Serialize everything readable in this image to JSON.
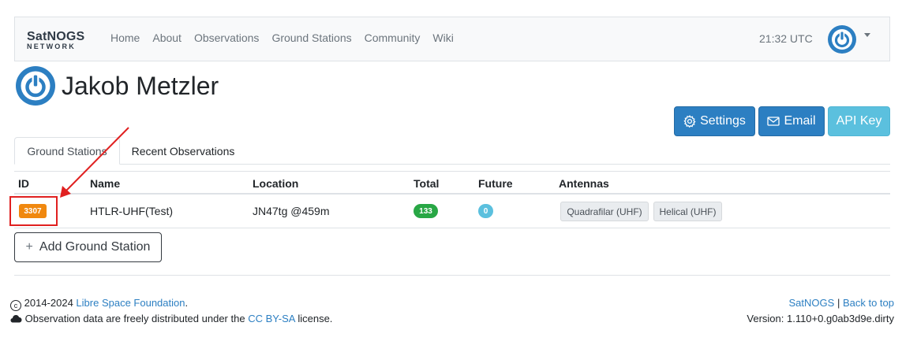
{
  "navbar": {
    "brand_top": "SatNOGS",
    "brand_bottom": "NETWORK",
    "links": [
      "Home",
      "About",
      "Observations",
      "Ground Stations",
      "Community",
      "Wiki"
    ],
    "time": "21:32 UTC",
    "user_icon": "power-icon"
  },
  "profile": {
    "name": "Jakob Metzler",
    "avatar_icon": "power-icon"
  },
  "actions": {
    "settings_label": "Settings",
    "email_label": "Email",
    "api_key_label": "API Key"
  },
  "tabs": [
    {
      "label": "Ground Stations",
      "active": true
    },
    {
      "label": "Recent Observations",
      "active": false
    }
  ],
  "table": {
    "columns": [
      "ID",
      "Name",
      "Location",
      "Total",
      "Future",
      "Antennas"
    ],
    "rows": [
      {
        "id": "3307",
        "name": "HTLR-UHF(Test)",
        "location": "JN47tg @459m",
        "total": "133",
        "future": "0",
        "antennas": [
          "Quadrafilar (UHF)",
          "Helical (UHF)"
        ]
      }
    ]
  },
  "add_station": {
    "icon": "+",
    "label": "Add Ground Station"
  },
  "footer": {
    "copyright_prefix": "2014-2024",
    "org_link": "Libre Space Foundation",
    "period": ".",
    "license_prefix": "Observation data are freely distributed under the",
    "license_link": "CC BY-SA",
    "license_suffix": "license.",
    "satnogs_link": "SatNOGS",
    "separator": "|",
    "back_to_top": "Back to top",
    "version": "Version: 1.110+0.g0ab3d9e.dirty"
  },
  "colors": {
    "primary": "#2c7fc2",
    "info": "#5bc0de",
    "success": "#28a745",
    "station_badge": "#f0880f",
    "annotation": "#e02020"
  }
}
